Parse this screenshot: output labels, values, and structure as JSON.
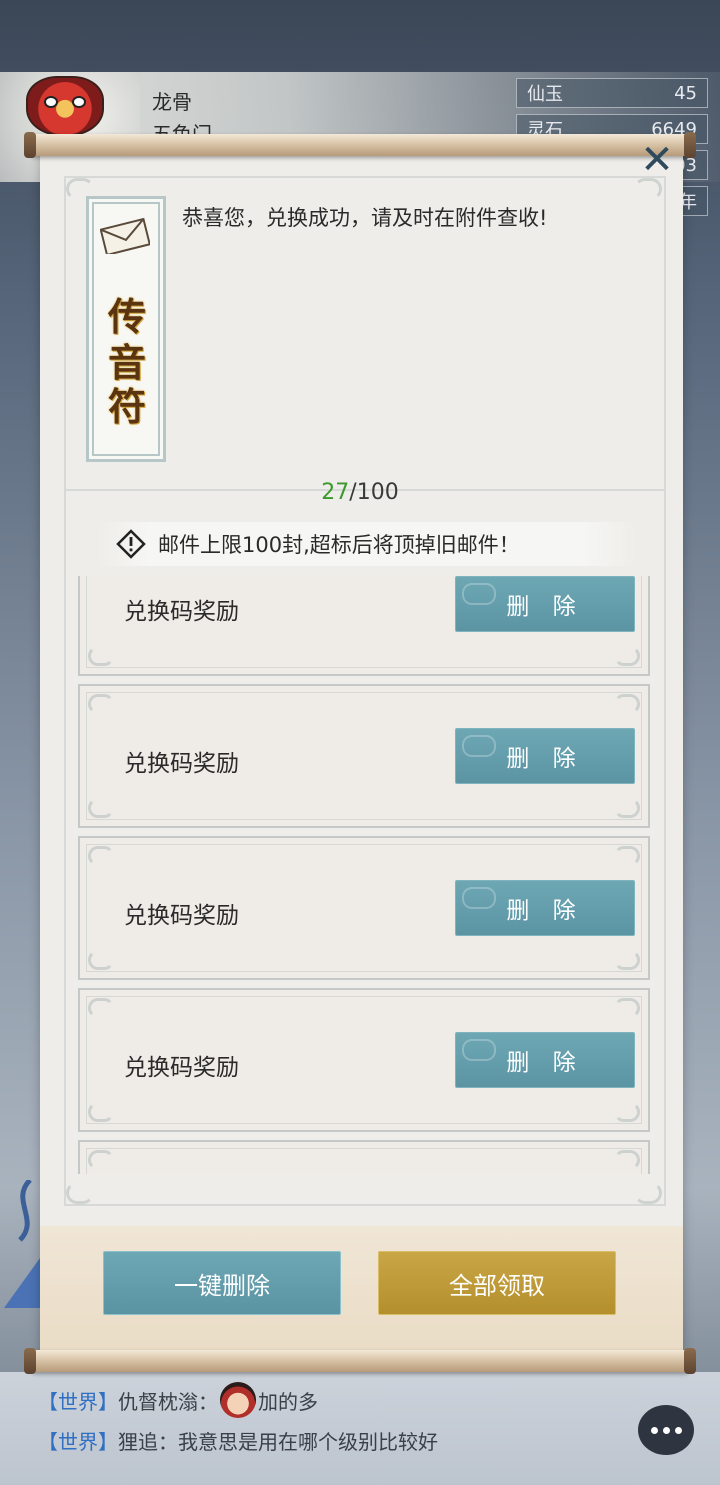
{
  "player": {
    "name": "龙骨",
    "sect": "五色门"
  },
  "resources": [
    {
      "name": "仙玉",
      "value": "45"
    },
    {
      "name": "灵石",
      "value": "6649"
    },
    {
      "name": "",
      "value": "03"
    },
    {
      "name": "",
      "value": "年"
    }
  ],
  "mail_dialog": {
    "title_chars": [
      "传",
      "音",
      "符"
    ],
    "message": "恭喜您，兑换成功，请及时在附件查收!",
    "count_current": "27",
    "count_max": "/100",
    "notice": "邮件上限100封,超标后将顶掉旧邮件！",
    "items": [
      {
        "label": "兑换码奖励",
        "action": "删 除"
      },
      {
        "label": "兑换码奖励",
        "action": "删 除"
      },
      {
        "label": "兑换码奖励",
        "action": "删 除"
      },
      {
        "label": "兑换码奖励",
        "action": "删 除"
      }
    ],
    "delete_all_label": "一键删除",
    "claim_all_label": "全部领取"
  },
  "chat": [
    {
      "channel": "【世界】",
      "sender": "仇督枕滃：",
      "message": "加的多"
    },
    {
      "channel": "【世界】",
      "sender": "狸追：",
      "message": "我意思是用在哪个级别比较好"
    }
  ],
  "colors": {
    "delete_button": "#5f98a6",
    "claim_button": "#bf9b38",
    "count_current": "#3c9a2d",
    "chat_channel": "#2f6fc4"
  },
  "icons": {
    "close": "close-icon",
    "envelope": "envelope-icon",
    "warning": "warning-icon",
    "chat": "chat-bubble-icon"
  }
}
